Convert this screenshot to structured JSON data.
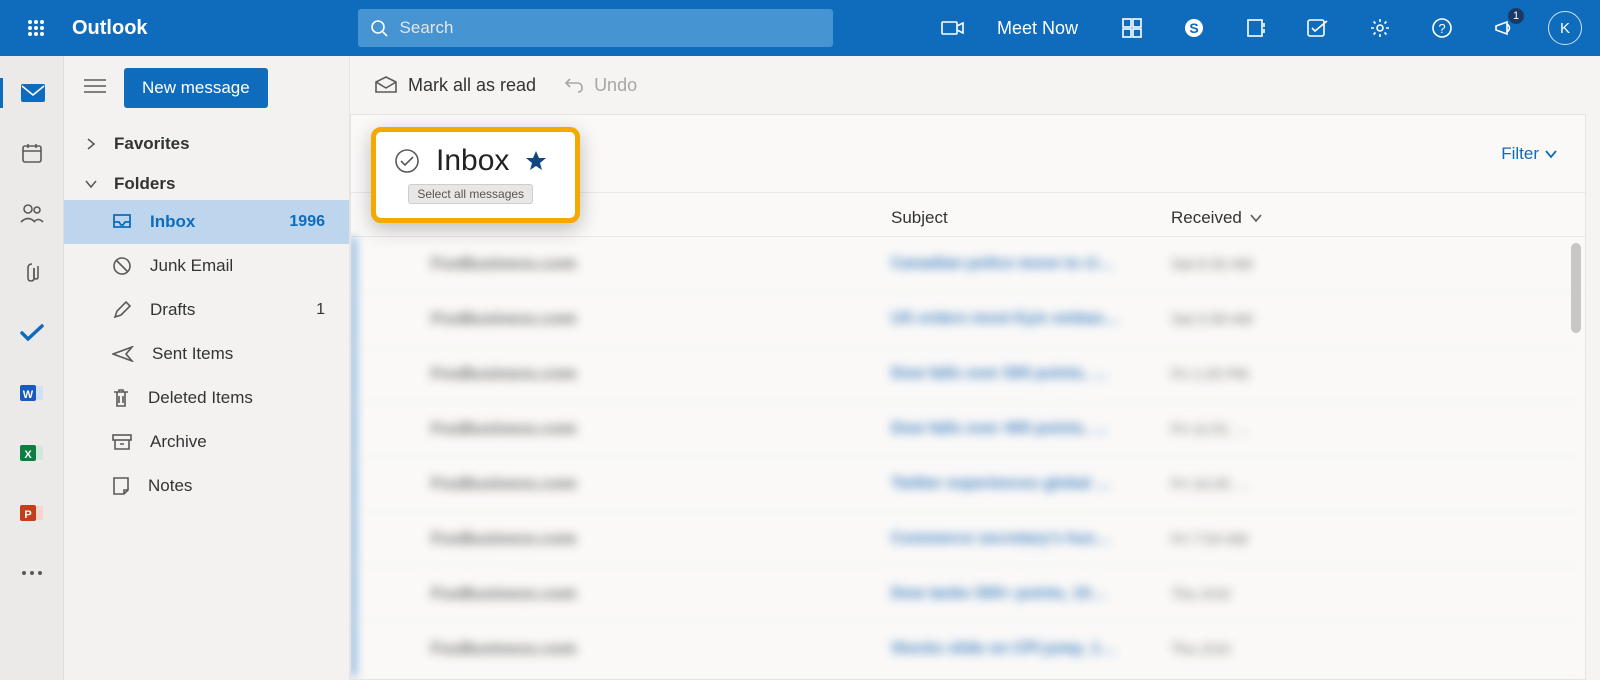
{
  "header": {
    "brand": "Outlook",
    "search_placeholder": "Search",
    "meet_now": "Meet Now",
    "avatar_initial": "K",
    "notif_badge": "1"
  },
  "commands": {
    "new_message": "New message",
    "mark_all_read": "Mark all as read",
    "undo": "Undo"
  },
  "nav": {
    "favorites": "Favorites",
    "folders": "Folders",
    "items": [
      {
        "label": "Inbox",
        "count": "1996",
        "active": true
      },
      {
        "label": "Junk Email"
      },
      {
        "label": "Drafts",
        "count": "1"
      },
      {
        "label": "Sent Items"
      },
      {
        "label": "Deleted Items"
      },
      {
        "label": "Archive"
      },
      {
        "label": "Notes"
      }
    ]
  },
  "list": {
    "title": "Inbox",
    "tooltip": "Select all messages",
    "filter": "Filter",
    "col_subject": "Subject",
    "col_received": "Received",
    "rows": [
      {
        "from": "FoxBusiness.com",
        "subject": "Canadian police move to cl…",
        "time": "Sat 6:32 AM",
        "unread": true
      },
      {
        "from": "FoxBusiness.com",
        "subject": "US orders most Kyiv embas…",
        "time": "Sat 3:39 AM",
        "unread": true
      },
      {
        "from": "FoxBusiness.com",
        "subject": "Dow falls over 500 points, …",
        "time": "Fri 1:25 PM",
        "unread": true
      },
      {
        "from": "FoxBusiness.com",
        "subject": "Dow falls over 400 points, …",
        "time": "Fri 11:51 …",
        "unread": true
      },
      {
        "from": "FoxBusiness.com",
        "subject": "Twitter experiences global …",
        "time": "Fri 10:25 …",
        "unread": true
      },
      {
        "from": "FoxBusiness.com",
        "subject": "Commerce secretary's hus…",
        "time": "Fri 7:54 AM",
        "unread": true
      },
      {
        "from": "FoxBusiness.com",
        "subject": "Dow tanks 500+ points, 10…",
        "time": "Thu 2/10",
        "unread": true
      },
      {
        "from": "FoxBusiness.com",
        "subject": "Stocks slide on CPI jump, 1…",
        "time": "Thu 2/10",
        "unread": true
      }
    ]
  }
}
